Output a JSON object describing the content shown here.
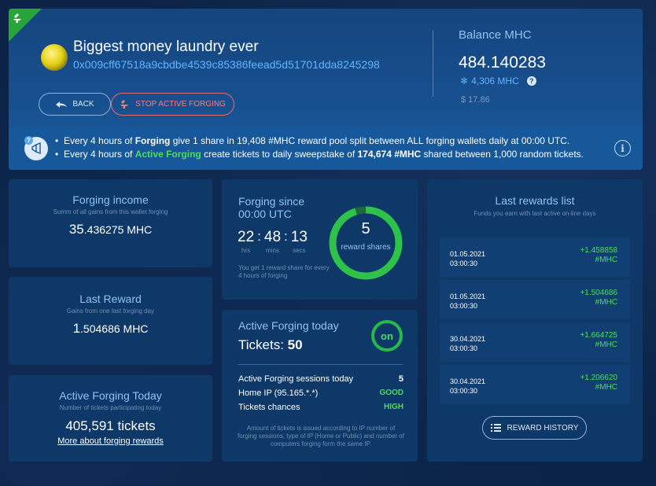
{
  "header": {
    "wallet_name": "Biggest money laundry ever",
    "wallet_address": "0x009cff67518a9cbdbe4539c85386feead5d51701dda8245298",
    "back_label": "BACK",
    "stop_label": "STOP ACTIVE FORGING",
    "balance_label": "Balance MHC",
    "balance_value": "484.140283",
    "frozen_value": "4,306 MHC",
    "balance_usd": "$ 17.86"
  },
  "info": {
    "l1_a": "Every 4 hours of ",
    "l1_b": "Forging",
    "l1_c": " give 1 share in 19,408 #MHC reward pool split between ALL forging wallets daily at 00:00 UTC.",
    "l2_a": "Every 4 hours of ",
    "l2_b": "Active Forging",
    "l2_c": " create tickets to daily sweepstake of ",
    "l2_d": "174,674 #MHC",
    "l2_e": " shared between 1,000 random tickets."
  },
  "income": {
    "title": "Forging income",
    "subtitle": "Summ of all gains from this wallet forging",
    "value_int": "35",
    "value_dec": ".436275 MHC"
  },
  "last_reward": {
    "title": "Last Reward",
    "subtitle": "Gains from one last forging day",
    "value_int": "1",
    "value_dec": ".504686 MHC"
  },
  "active_today": {
    "title": "Active Forging Today",
    "subtitle": "Number of tickets participating today",
    "value": "405,591 tickets",
    "link": "More about forging rewards"
  },
  "since": {
    "title": "Forging since 00:00 UTC",
    "hours": "22",
    "minutes": "48",
    "seconds": "13",
    "hrs_label": "hrs",
    "mins_label": "mins",
    "secs_label": "secs",
    "note": "You get 1 reward share for every 4 hours of forging",
    "shares": "5",
    "shares_label": "reward shares",
    "ring_progress": 0.95
  },
  "forging_today": {
    "title": "Active Forging today",
    "tickets_label": "Tickets: ",
    "tickets_value": "50",
    "badge": "on",
    "rows": [
      {
        "label": "Active Forging sessions today",
        "value": "5"
      },
      {
        "label": "Home IP (95.165.*.*)",
        "value": "GOOD"
      },
      {
        "label": "Tickets chances",
        "value": "HIGH"
      }
    ],
    "note": "Amount of tickets is issued according to IP number of forging sessions, type of IP (Home or Public) and number of computers forging form the same IP."
  },
  "rewards": {
    "title": "Last rewards list",
    "subtitle": "Funds you earn with last active on-line days",
    "items": [
      {
        "date": "01.05.2021",
        "time": "03:00:30",
        "amount": "+1.458858",
        "unit": "#MHC"
      },
      {
        "date": "01.05.2021",
        "time": "03:00:30",
        "amount": "+1.504686",
        "unit": "#MHC"
      },
      {
        "date": "30.04.2021",
        "time": "03:00:30",
        "amount": "+1.664725",
        "unit": "#MHC"
      },
      {
        "date": "30.04.2021",
        "time": "03:00:30",
        "amount": "+1.206620",
        "unit": "#MHC"
      }
    ],
    "history_label": "REWARD HISTORY"
  },
  "colors": {
    "accent_blue": "#5fb4ff",
    "green": "#4ddc5c",
    "stop_red": "#ff7a7a",
    "panel_bg": "#0e3868"
  }
}
